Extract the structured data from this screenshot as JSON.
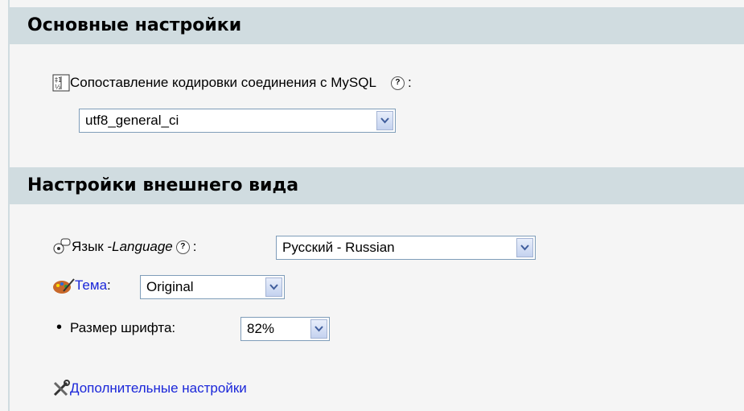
{
  "general": {
    "title": "Основные настройки",
    "collation_label": "Сопоставление кодировки соединения с MySQL",
    "help_text": "?",
    "colon": ":",
    "collation_value": "utf8_general_ci"
  },
  "appearance": {
    "title": "Настройки внешнего вида",
    "language_prefix": "Язык - ",
    "language_italic": "Language",
    "language_value": "Русский - Russian",
    "theme_label": "Тема",
    "theme_value": "Original",
    "font_size_label": "Размер шрифта:",
    "font_size_value": "82%",
    "more_settings": "Дополнительные настройки"
  }
}
